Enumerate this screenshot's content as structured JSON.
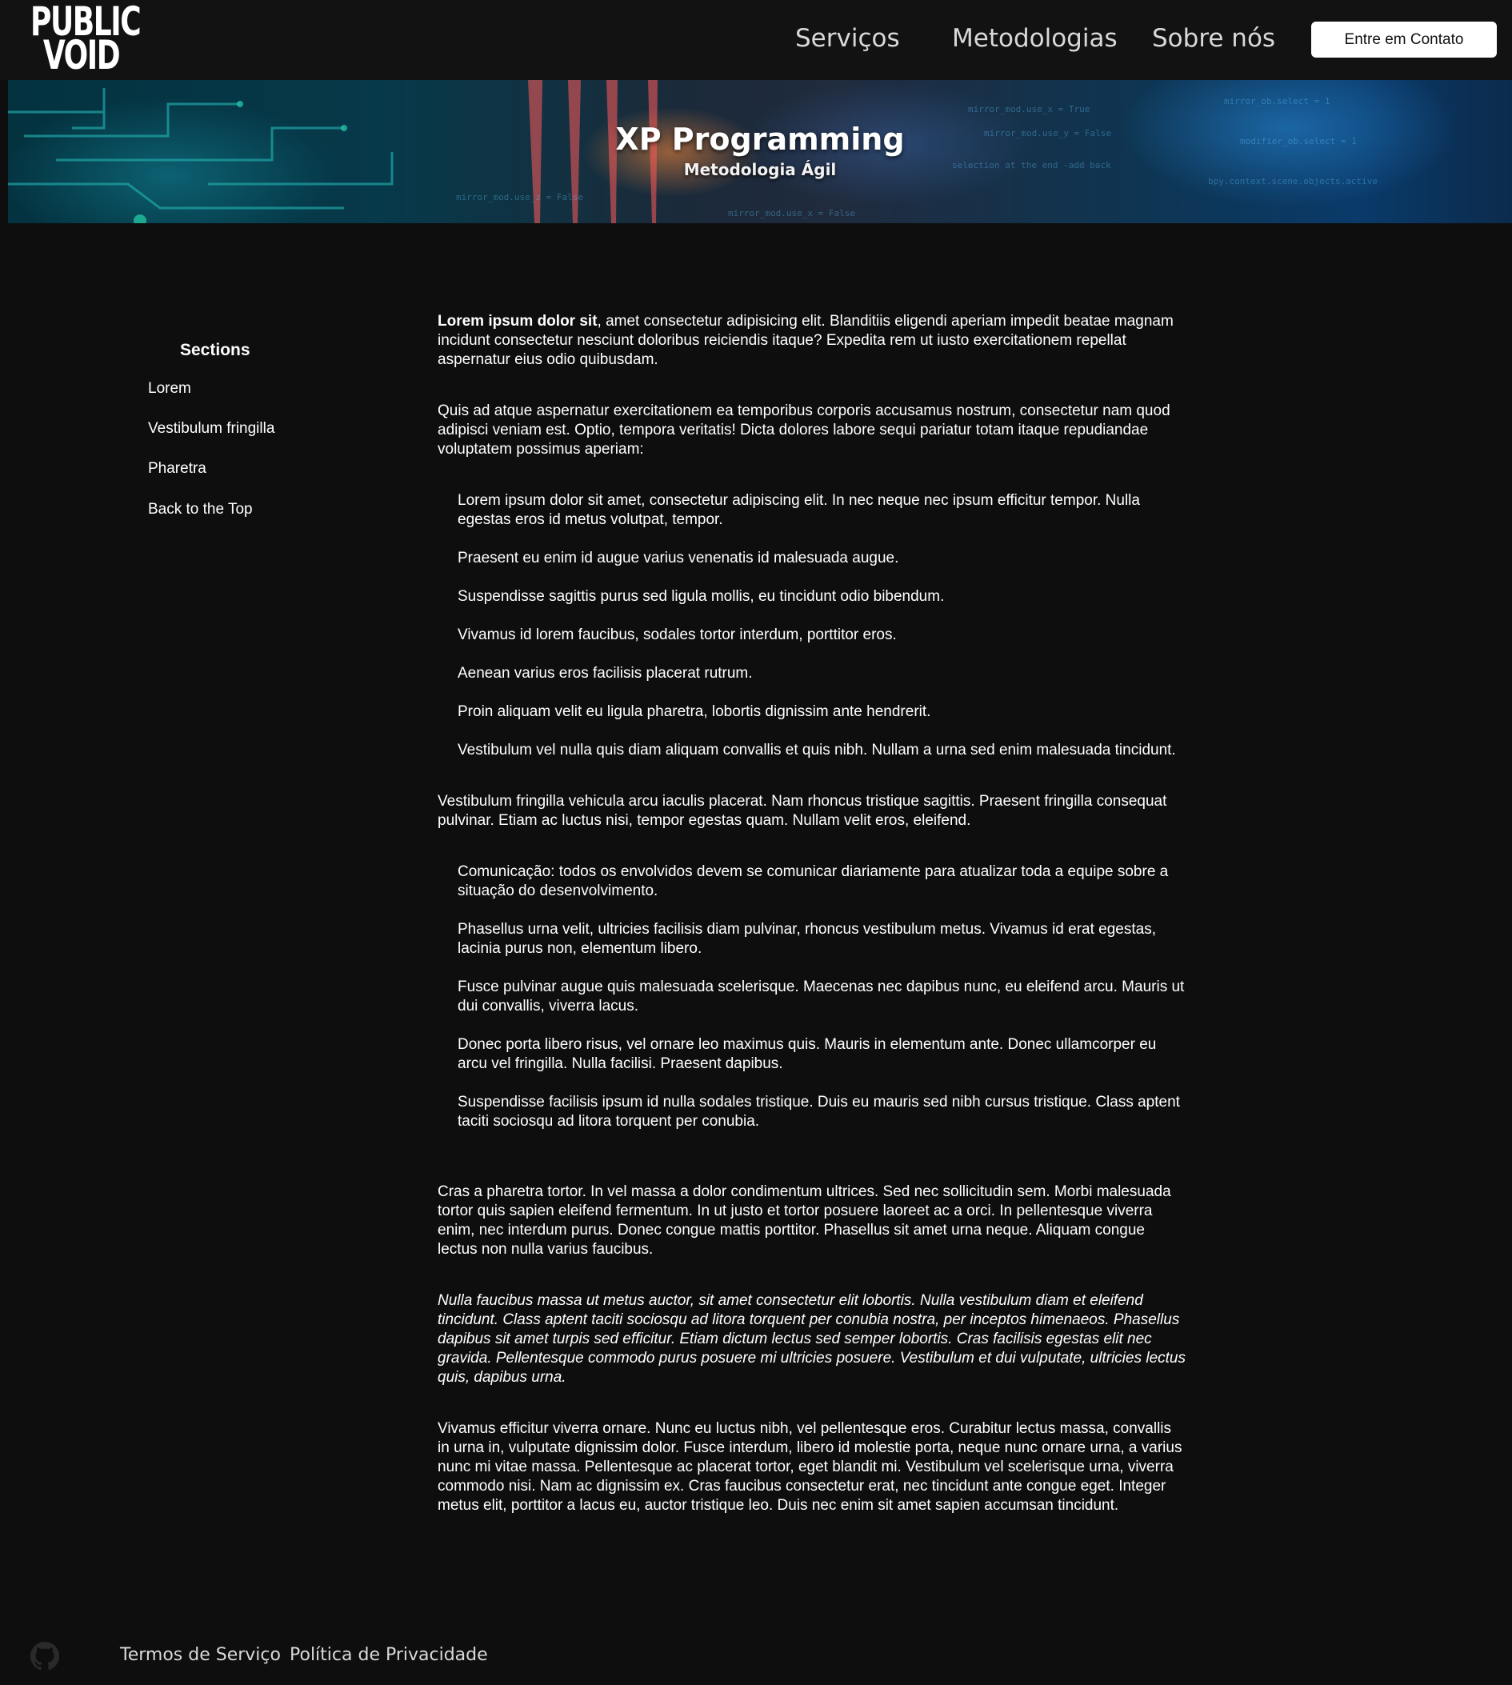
{
  "header": {
    "logo_line1": "PUBLIC",
    "logo_line2": "VOID",
    "nav": [
      "Serviços",
      "Metodologias",
      "Sobre nós"
    ],
    "cta_label": "Entre em Contato"
  },
  "hero": {
    "title": "XP Programming",
    "subtitle": "Metodologia Ágil"
  },
  "sidebar": {
    "title": "Sections",
    "items": [
      "Lorem",
      "Vestibulum fringilla",
      "Pharetra",
      "Back to the Top"
    ]
  },
  "content": {
    "p1_bold": "Lorem ipsum dolor sit",
    "p1_rest": ", amet consectetur adipisicing elit. Blanditiis eligendi aperiam impedit beatae magnam incidunt consectetur nesciunt doloribus reiciendis itaque? Expedita rem ut iusto exercitationem repellat aspernatur eius odio quibusdam.",
    "p2": "Quis ad atque aspernatur exercitationem ea temporibus corporis accusamus nostrum, consectetur nam quod adipisci veniam est. Optio, tempora veritatis! Dicta dolores labore sequi pariatur totam itaque repudiandae voluptatem possimus aperiam:",
    "list1": [
      "Lorem ipsum dolor sit amet, consectetur adipiscing elit. In nec neque nec ipsum efficitur tempor. Nulla egestas eros id metus volutpat, tempor.",
      "Praesent eu enim id augue varius venenatis id malesuada augue.",
      "Suspendisse sagittis purus sed ligula mollis, eu tincidunt odio bibendum.",
      "Vivamus id lorem faucibus, sodales tortor interdum, porttitor eros.",
      "Aenean varius eros facilisis placerat rutrum.",
      "Proin aliquam velit eu ligula pharetra, lobortis dignissim ante hendrerit.",
      "Vestibulum vel nulla quis diam aliquam convallis et quis nibh. Nullam a urna sed enim malesuada tincidunt."
    ],
    "p3": "Vestibulum fringilla vehicula arcu iaculis placerat. Nam rhoncus tristique sagittis. Praesent fringilla consequat pulvinar. Etiam ac luctus nisi, tempor egestas quam. Nullam velit eros, eleifend.",
    "list2": [
      "Comunicação: todos os envolvidos devem se comunicar diariamente para atualizar toda a equipe sobre a situação do desenvolvimento.",
      "Phasellus urna velit, ultricies facilisis diam pulvinar, rhoncus vestibulum metus. Vivamus id erat egestas, lacinia purus non, elementum libero.",
      "Fusce pulvinar augue quis malesuada scelerisque. Maecenas nec dapibus nunc, eu eleifend arcu. Mauris ut dui convallis, viverra lacus.",
      "Donec porta libero risus, vel ornare leo maximus quis. Mauris in elementum ante. Donec ullamcorper eu arcu vel fringilla. Nulla facilisi. Praesent dapibus.",
      "Suspendisse facilisis ipsum id nulla sodales tristique. Duis eu mauris sed nibh cursus tristique. Class aptent taciti sociosqu ad litora torquent per conubia."
    ],
    "p4": "Cras a pharetra tortor. In vel massa a dolor condimentum ultrices. Sed nec sollicitudin sem. Morbi malesuada tortor quis sapien eleifend fermentum. In ut justo et tortor posuere laoreet ac a orci. In pellentesque viverra enim, nec interdum purus. Donec congue mattis porttitor. Phasellus sit amet urna neque. Aliquam congue lectus non nulla varius faucibus.",
    "p5_italic": "Nulla faucibus massa ut metus auctor, sit amet consectetur elit lobortis. Nulla vestibulum diam et eleifend tincidunt. Class aptent taciti sociosqu ad litora torquent per conubia nostra, per inceptos himenaeos. Phasellus dapibus sit amet turpis sed efficitur. Etiam dictum lectus sed semper lobortis. Cras facilisis egestas elit nec gravida. Pellentesque commodo purus posuere mi ultricies posuere. Vestibulum et dui vulputate, ultricies lectus quis, dapibus urna.",
    "p6": "Vivamus efficitur viverra ornare. Nunc eu luctus nibh, vel pellentesque eros. Curabitur lectus massa, convallis in urna in, vulputate dignissim dolor. Fusce interdum, libero id molestie porta, neque nunc ornare urna, a varius nunc mi vitae massa. Pellentesque ac placerat tortor, eget blandit mi. Vestibulum vel scelerisque urna, viverra commodo nisi. Nam ac dignissim ex. Cras faucibus consectetur erat, nec tincidunt ante congue eget. Integer metus elit, porttitor a lacus eu, auctor tristique leo. Duis nec enim sit amet sapien accumsan tincidunt."
  },
  "footer": {
    "icon": "github-icon",
    "links": [
      "Termos de Serviço",
      "Política de Privacidade"
    ]
  },
  "colors": {
    "background": "#0e0e0e",
    "header": "#121212",
    "text": "#ffffff",
    "nav_text": "#d9d9d9"
  }
}
